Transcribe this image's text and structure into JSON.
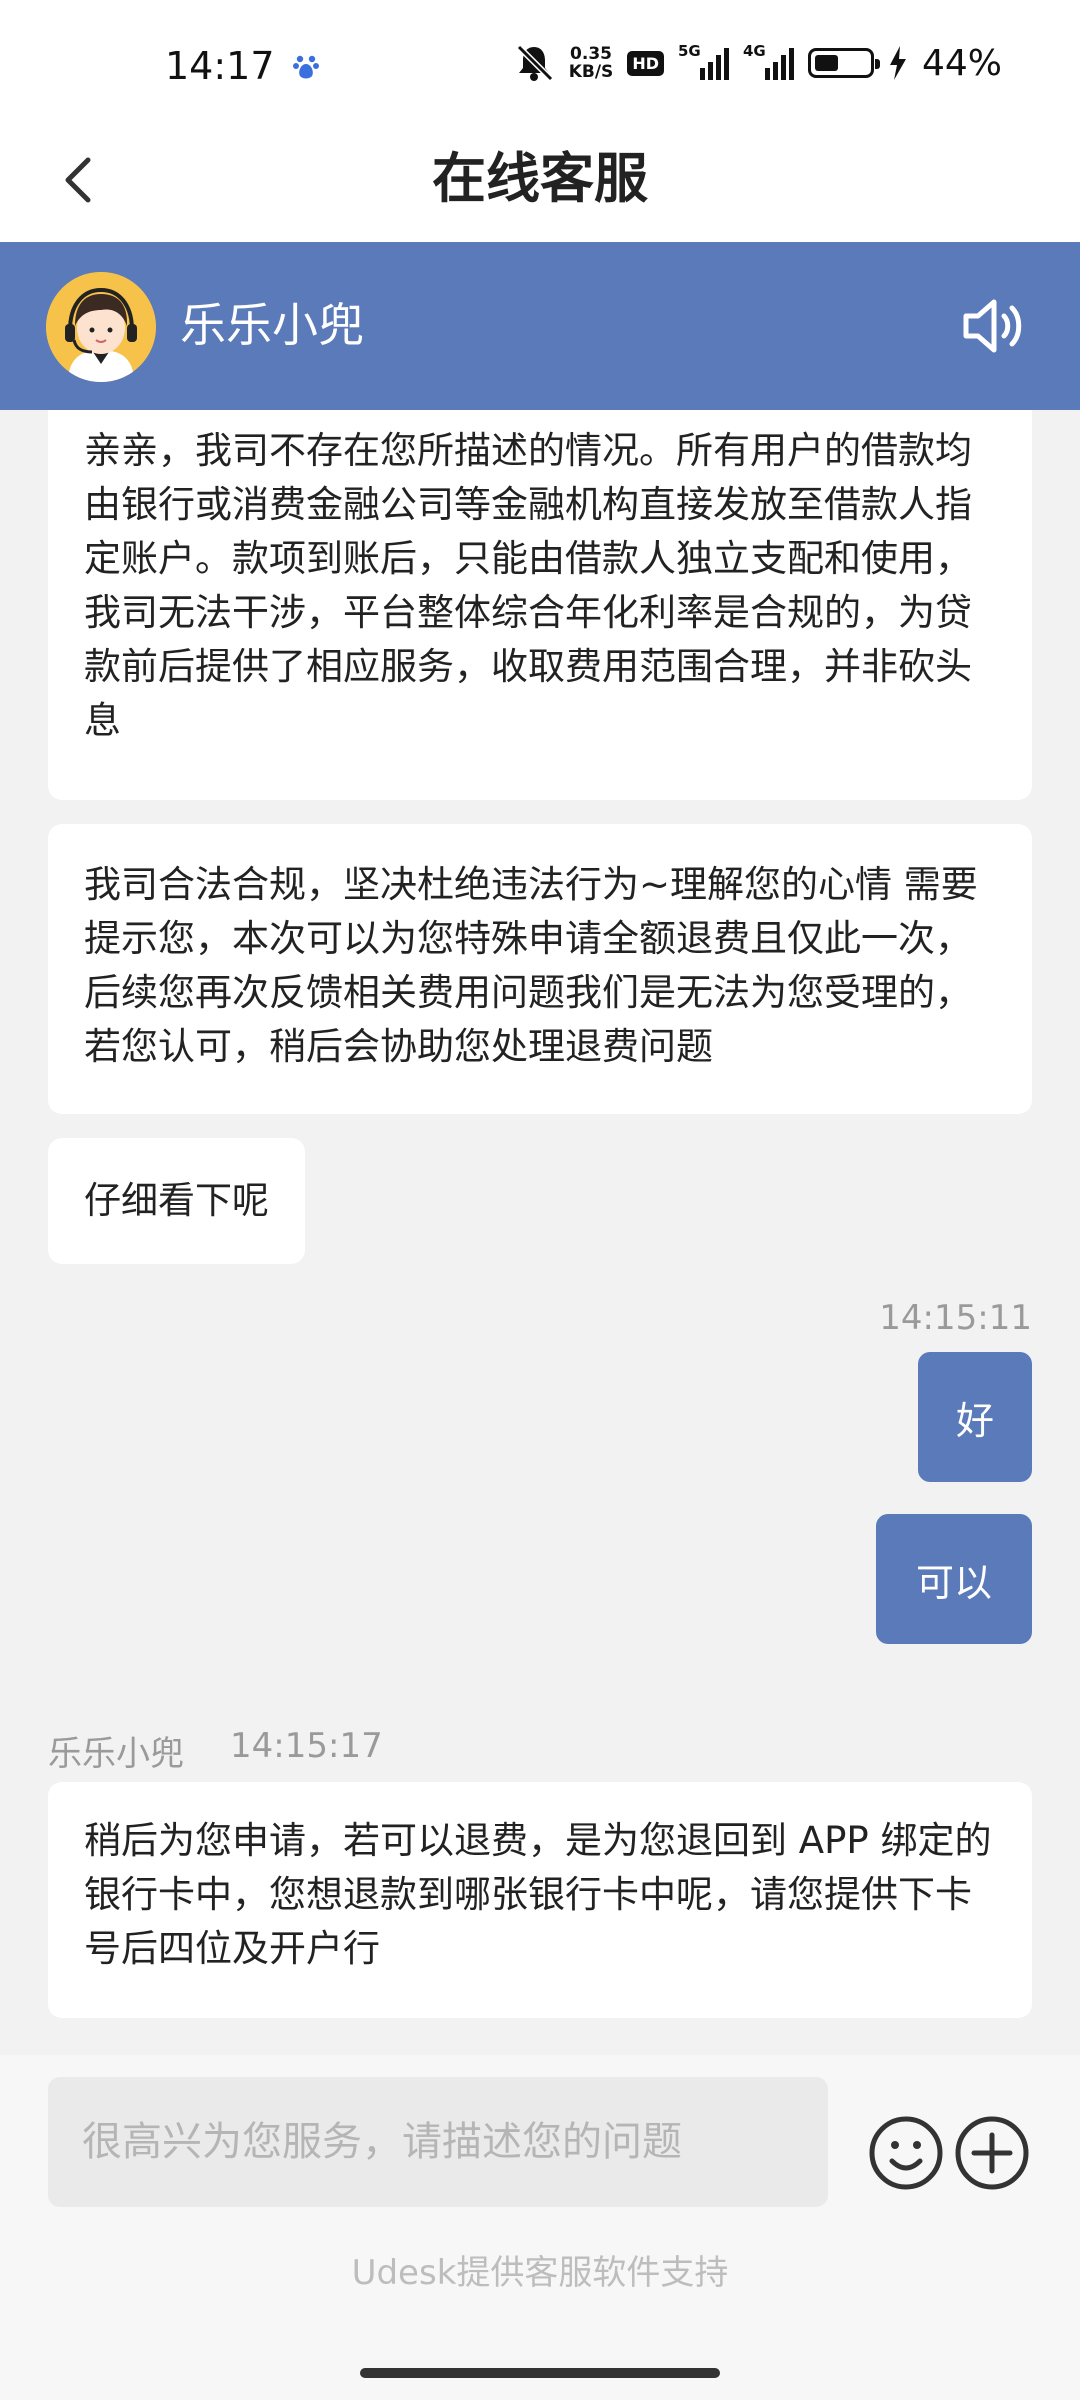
{
  "status": {
    "time": "14:17",
    "net_speed_value": "0.35",
    "net_speed_unit": "KB/S",
    "hd": "HD",
    "sim1": "5G",
    "sim2": "4G",
    "battery": "44%",
    "battery_level": 0.44
  },
  "nav": {
    "title": "在线客服"
  },
  "agent": {
    "name": "乐乐小兜"
  },
  "messages": {
    "m1": "亲亲，我司不存在您所描述的情况。所有用户的借款均由银行或消费金融公司等金融机构直接发放至借款人指定账户。款项到账后，只能由借款人独立支配和使用，我司无法干涉，平台整体综合年化利率是合规的，为贷款前后提供了相应服务，收取费用范围合理，并非砍头息",
    "m2": "我司合法合规，坚决杜绝违法行为~理解您的心情 需要提示您，本次可以为您特殊申请全额退费且仅此一次，后续您再次反馈相关费用问题我们是无法为您受理的，若您认可，稍后会协助您处理退费问题",
    "m3": "仔细看下呢",
    "ts1": "14:15:11",
    "u1": "好",
    "u2": "可以",
    "agent_label": "乐乐小兜",
    "ts2": "14:15:17",
    "m4": "稍后为您申请，若可以退费，是为您退回到 APP 绑定的银行卡中，您想退款到哪张银行卡中呢，请您提供下卡号后四位及开户行"
  },
  "input": {
    "placeholder": "很高兴为您服务，请描述您的问题",
    "value": ""
  },
  "footer": {
    "powered_by": "Udesk提供客服软件支持"
  },
  "icons": {
    "back": "chevron-left-icon",
    "speaker": "speaker-icon",
    "emoji": "smiley-icon",
    "plus": "plus-circle-icon"
  },
  "colors": {
    "brand": "#5b7ab9",
    "background": "#f2f2f2",
    "bubble": "#ffffff"
  }
}
